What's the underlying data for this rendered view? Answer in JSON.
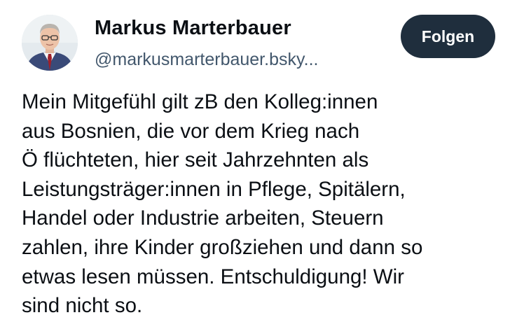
{
  "author": {
    "name": "Markus Marterbauer",
    "handle": "@markusmarterbauer.bsky..."
  },
  "follow_button": {
    "label": "Folgen"
  },
  "post": {
    "lines": [
      "Mein Mitgefühl gilt zB den Kolleg:innen",
      "aus Bosnien, die vor dem Krieg nach",
      "Ö flüchteten, hier seit Jahrzehnten als",
      "Leistungsträger:innen in Pflege, Spitälern,",
      "Handel oder Industrie arbeiten, Steuern",
      "zahlen, ihre Kinder großziehen und dann so",
      "etwas lesen müssen. Entschuldigung! Wir",
      "sind nicht so."
    ]
  },
  "colors": {
    "text": "#0b0f14",
    "handle": "#42576c",
    "button_bg": "#1f2e3d",
    "button_text": "#ffffff"
  }
}
